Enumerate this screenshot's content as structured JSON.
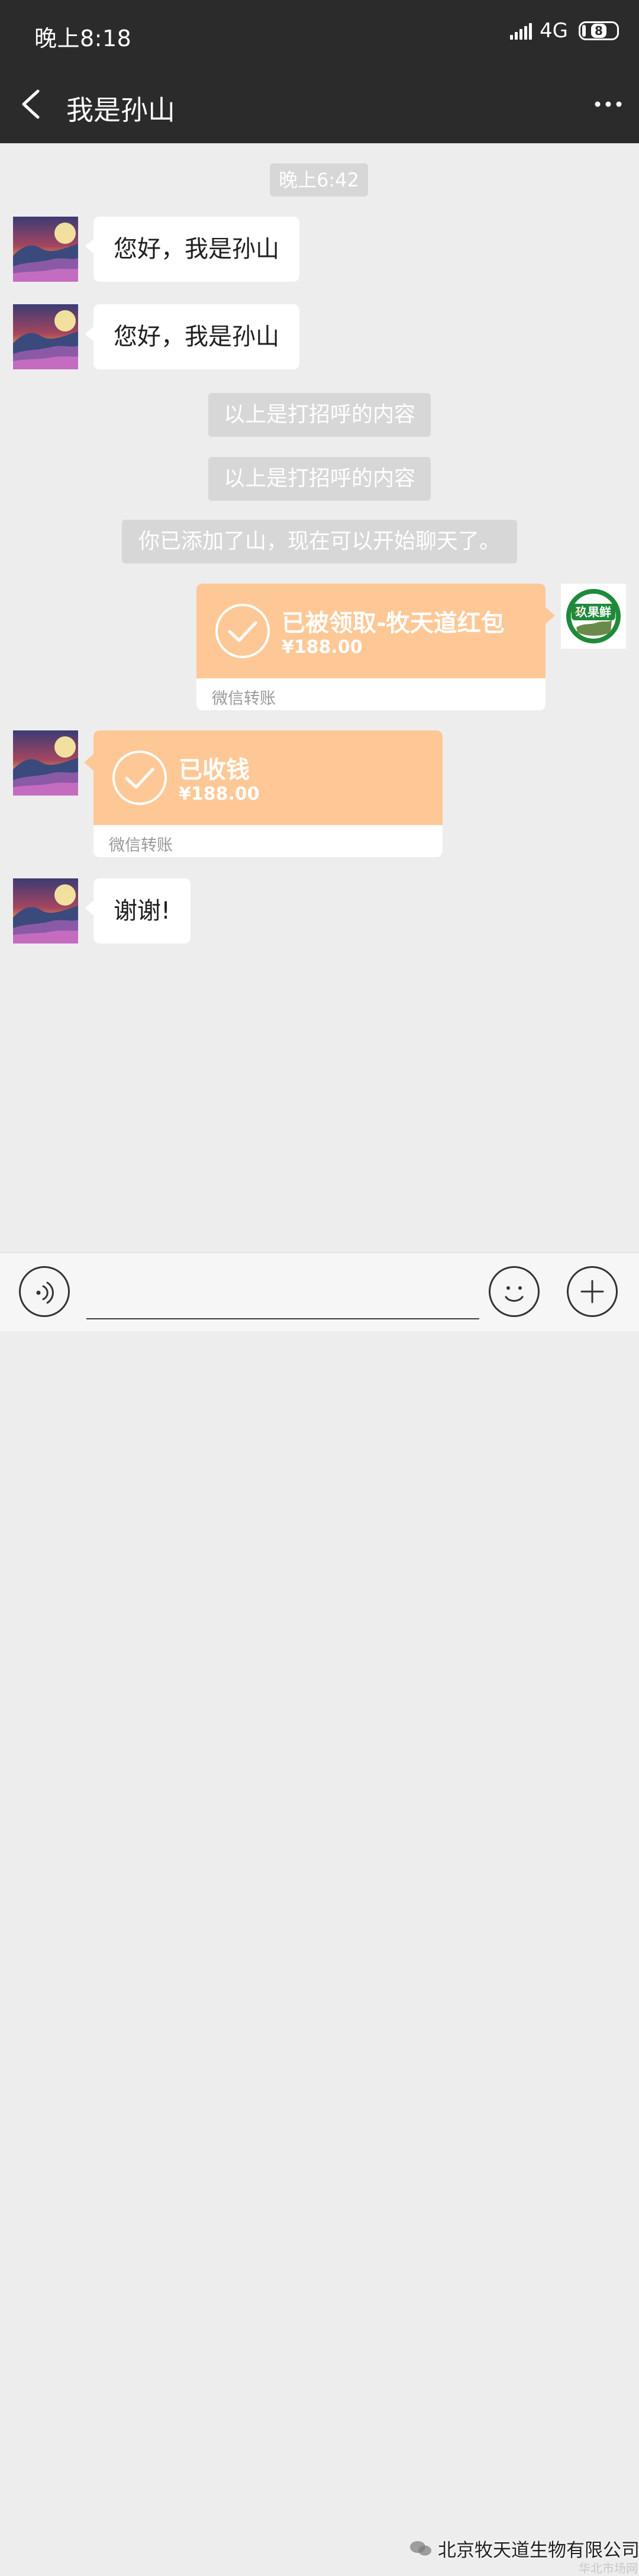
{
  "status_bar": {
    "time": "晚上8:18",
    "network": "4G",
    "battery": "8"
  },
  "nav": {
    "title": "我是孙山",
    "back_icon": "chevron-left-icon",
    "more_icon": "more-dots-icon"
  },
  "chat": {
    "time_tag": "晚上6:42",
    "messages": [
      {
        "text": "您好，我是孙山"
      },
      {
        "text": "您好，我是孙山"
      },
      {
        "text": "谢谢!"
      }
    ],
    "system_messages": [
      "以上是打招呼的内容",
      "以上是打招呼的内容",
      "你已添加了山，现在可以开始聊天了。"
    ],
    "transfer_sent": {
      "title": "已被领取-牧天道红包",
      "amount": "¥188.00",
      "footer": "微信转账",
      "status_icon": "check-circle-icon"
    },
    "transfer_received": {
      "title": "已收钱",
      "amount": "¥188.00",
      "footer": "微信转账",
      "status_icon": "check-circle-icon"
    },
    "self_avatar_text": "玖果鲜"
  },
  "input_bar": {
    "voice_icon": "voice-icon",
    "emoji_icon": "emoji-icon",
    "plus_icon": "plus-icon"
  },
  "watermark": {
    "text": "北京牧天道生物有限公司",
    "small_text": "华北市场网"
  },
  "colors": {
    "header_bg": "#2b2b2b",
    "chat_bg": "#ededed",
    "transfer_orange": "#fec896",
    "system_bubble": "#d7d7d7"
  }
}
